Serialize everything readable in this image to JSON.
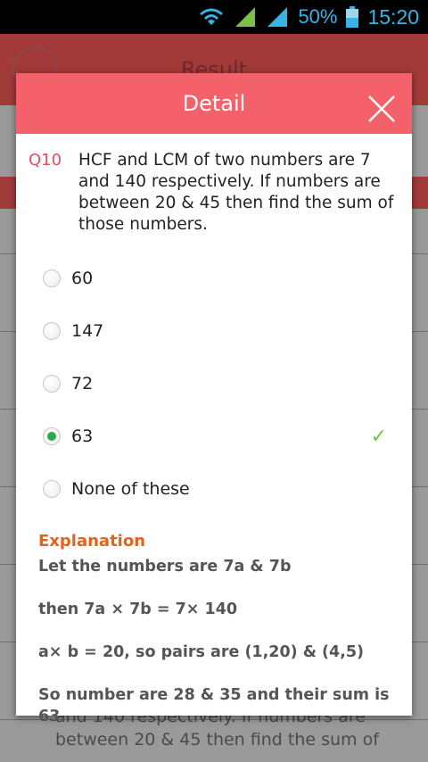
{
  "status": {
    "battery": "50%",
    "time": "15:20"
  },
  "background": {
    "header_title": "Result",
    "question_fragment_line1": "and 140 respectively. If numbers are",
    "question_fragment_line2": "between 20 & 45 then find the sum of"
  },
  "dialog": {
    "title": "Detail",
    "question_number": "Q10",
    "question_text": "HCF and LCM of two numbers are 7 and 140 respectively. If numbers are between 20 & 45 then find the sum of those numbers.",
    "options": [
      {
        "label": "60",
        "selected": false,
        "correct": false
      },
      {
        "label": "147",
        "selected": false,
        "correct": false
      },
      {
        "label": "72",
        "selected": false,
        "correct": false
      },
      {
        "label": "63",
        "selected": true,
        "correct": true
      },
      {
        "label": "None of these",
        "selected": false,
        "correct": false
      }
    ],
    "explanation_title": "Explanation",
    "explanation_lines": [
      "Let the numbers are 7a & 7b",
      "then 7a × 7b = 7× 140",
      "a× b = 20, so pairs are (1,20) & (4,5)",
      "So number are 28 & 35 and their sum is 63."
    ]
  },
  "colors": {
    "header": "#f4616a",
    "question_number": "#e05060",
    "explanation_title": "#e0641e",
    "radio_checked": "#2aa84a",
    "check_mark": "#7ac043",
    "status_icons": "#35b5e5"
  },
  "icons": {
    "wifi": "wifi-icon",
    "signal": "signal-icon",
    "battery": "battery-icon",
    "close": "close-icon",
    "check": "check-icon"
  }
}
